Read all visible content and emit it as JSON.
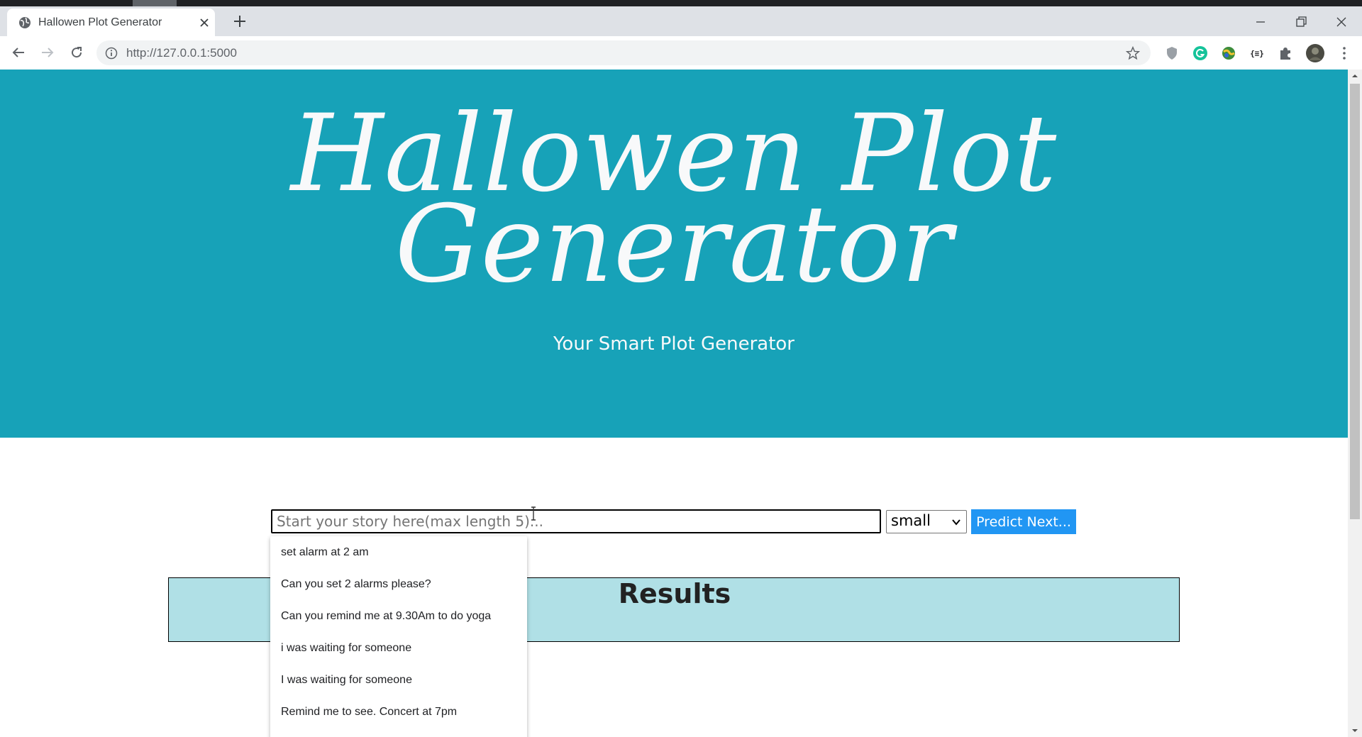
{
  "browser": {
    "tab_title": "Hallowen Plot Generator",
    "url": "http://127.0.0.1:5000",
    "favicon": "globe-icon",
    "extension_icons": [
      "shield-icon",
      "grammarly-icon",
      "map-extension-icon",
      "json-icon",
      "puzzle-icon",
      "profile-avatar"
    ]
  },
  "hero": {
    "title": "Hallowen Plot Generator",
    "subtitle": "Your Smart Plot Generator",
    "background_color": "#17a2b8"
  },
  "form": {
    "story_placeholder": "Start your story here(max length 5)...",
    "size_selected": "small",
    "predict_label": "Predict Next...",
    "predict_color": "#2196f3"
  },
  "autocomplete": {
    "items": [
      "set alarm at 2 am",
      "Can you set 2 alarms please?",
      "Can you remind me at 9.30Am to do yoga",
      "i was waiting for someone",
      "I was waiting for someone",
      "Remind me to see. Concert at 7pm"
    ]
  },
  "results": {
    "title": "Results",
    "background_color": "#b0e0e6"
  }
}
